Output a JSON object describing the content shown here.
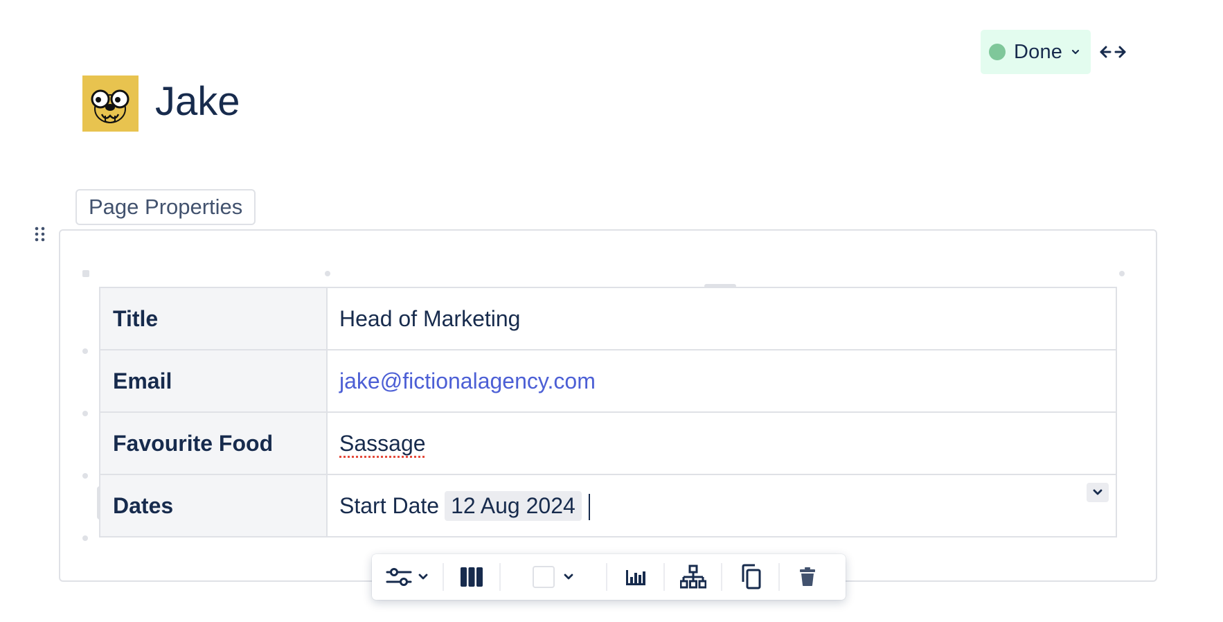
{
  "page": {
    "title": "Jake",
    "avatar_icon": "jake-dog-icon"
  },
  "status": {
    "label": "Done",
    "color": "#e3fcef",
    "dot_color": "#7fc79a"
  },
  "macro": {
    "label": "Page Properties"
  },
  "table": {
    "rows": [
      {
        "header": "Title",
        "value": "Head of Marketing"
      },
      {
        "header": "Email",
        "value": "jake@fictionalagency.com"
      },
      {
        "header": "Favourite Food",
        "value": "Sassage"
      },
      {
        "header": "Dates",
        "value_prefix": "Start Date",
        "date": "12 Aug 2024"
      }
    ]
  },
  "toolbar": {
    "items": [
      "table-options-icon",
      "column-layout-icon",
      "cell-background-color",
      "chart-icon",
      "hierarchy-icon",
      "copy-icon",
      "delete-icon"
    ]
  },
  "colors": {
    "text": "#172b4d",
    "link": "#4c5fd5",
    "header_bg": "#f4f5f7",
    "border": "#dfe1e6",
    "avatar_bg": "#e8c34f"
  }
}
